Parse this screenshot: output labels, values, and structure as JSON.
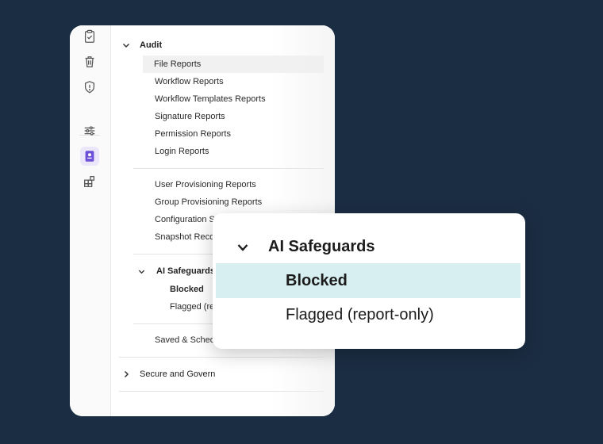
{
  "nav": {
    "audit": {
      "label": "Audit",
      "items": [
        "File Reports",
        "Workflow Reports",
        "Workflow Templates Reports",
        "Signature Reports",
        "Permission Reports",
        "Login Reports"
      ]
    },
    "provisioning_items": [
      "User Provisioning Reports",
      "Group Provisioning Reports",
      "Configuration S",
      "Snapshot Reco"
    ],
    "ai_safeguards": {
      "label": "AI Safeguards",
      "items": [
        "Blocked",
        "Flagged (re"
      ]
    },
    "saved": "Saved & Schedu",
    "secure_and_govern": "Secure and Govern"
  },
  "popup": {
    "title": "AI Safeguards",
    "items": [
      "Blocked",
      "Flagged (report-only)"
    ],
    "selected": "Blocked"
  },
  "colors": {
    "background": "#1b2d43",
    "rail_active": "#6b4fd8",
    "selected_row": "#d7eff0"
  },
  "icons": {
    "rail": [
      "clipboard-check-icon",
      "trash-icon",
      "shield-alert-icon",
      "sliders-icon",
      "report-icon",
      "apps-add-icon"
    ]
  }
}
